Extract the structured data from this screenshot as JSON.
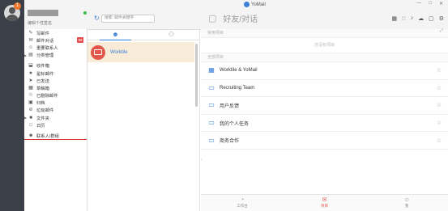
{
  "window": {
    "app_title": "YoMail",
    "minimize": "—",
    "maximize": "□",
    "close": "✕"
  },
  "rail": {
    "notification_count": "1"
  },
  "account": {
    "signature": "编辑个性签名"
  },
  "search": {
    "placeholder": "搜索: 邮件关键字"
  },
  "folders": [
    {
      "label": "写邮件",
      "icon": "compose-icon",
      "glyph": "✎"
    },
    {
      "label": "邮件对话",
      "icon": "mail-conversation-icon",
      "glyph": "✉",
      "badge": "99"
    },
    {
      "label": "重要联系人",
      "icon": "vip-contact-icon",
      "glyph": "☺"
    },
    {
      "label": "分类管理",
      "icon": "category-icon",
      "glyph": "▤",
      "caret": true
    },
    {
      "label": "收件箱",
      "icon": "inbox-icon",
      "glyph": "⬓"
    },
    {
      "label": "星标邮件",
      "icon": "star-mail-icon",
      "glyph": "★"
    },
    {
      "label": "已发送",
      "icon": "sent-icon",
      "glyph": "➤"
    },
    {
      "label": "草稿箱",
      "icon": "drafts-icon",
      "glyph": "▦"
    },
    {
      "label": "已删除邮件",
      "icon": "trash-icon",
      "glyph": "♲"
    },
    {
      "label": "归档",
      "icon": "archive-icon",
      "glyph": "▣"
    },
    {
      "label": "垃圾邮件",
      "icon": "spam-icon",
      "glyph": "⊘"
    },
    {
      "label": "文件夹",
      "icon": "folder-icon",
      "glyph": "■",
      "caret": true
    },
    {
      "label": "日历",
      "icon": "calendar-icon",
      "glyph": "□"
    },
    {
      "label": "联系人/群组",
      "icon": "contacts-icon",
      "glyph": "☻",
      "active": true
    }
  ],
  "mid_tabs": [
    {
      "icon": "person-icon",
      "glyph": "☻",
      "active": true
    },
    {
      "icon": "group-icon",
      "glyph": "⚇",
      "active": false
    }
  ],
  "conversation": {
    "label": "Worktile"
  },
  "chat_header": {
    "title": "好友/对话"
  },
  "toolbar_icons": [
    {
      "name": "grid-icon",
      "glyph": "▦"
    },
    {
      "name": "signal-icon",
      "glyph": "∷"
    },
    {
      "name": "bell-icon",
      "glyph": "♪"
    },
    {
      "name": "cloud-icon",
      "glyph": "☁"
    },
    {
      "name": "window-icon",
      "glyph": "▢"
    },
    {
      "name": "settings-icon",
      "glyph": "⚙"
    }
  ],
  "main": {
    "recent_header": "常用项目",
    "recent_empty": "还没有项目",
    "all_header": "全部项目",
    "projects": [
      {
        "name": "Worktile & YoMail",
        "icon": "board-icon",
        "glyph": "▦"
      },
      {
        "name": "Recruiting Team",
        "icon": "tray-icon",
        "glyph": "▭"
      },
      {
        "name": "用户反馈",
        "icon": "tray-icon",
        "glyph": "▭"
      },
      {
        "name": "我的个人任务",
        "icon": "tray-icon",
        "glyph": "▭"
      },
      {
        "name": "商务合作",
        "icon": "tray-icon",
        "glyph": "▭"
      }
    ]
  },
  "bottom_nav": [
    {
      "label": "工作台",
      "icon": "dashboard-icon",
      "glyph": "◔",
      "active": false
    },
    {
      "label": "项目",
      "icon": "project-icon",
      "glyph": "✉",
      "active": true
    },
    {
      "label": "我",
      "icon": "me-icon",
      "glyph": "☺",
      "active": false
    }
  ],
  "colors": {
    "accent": "#3a7fd5",
    "rail": "#3b3f47",
    "highlight": "#f8ecd9",
    "danger": "#e14b4b",
    "active_tab": "#e0544a"
  }
}
